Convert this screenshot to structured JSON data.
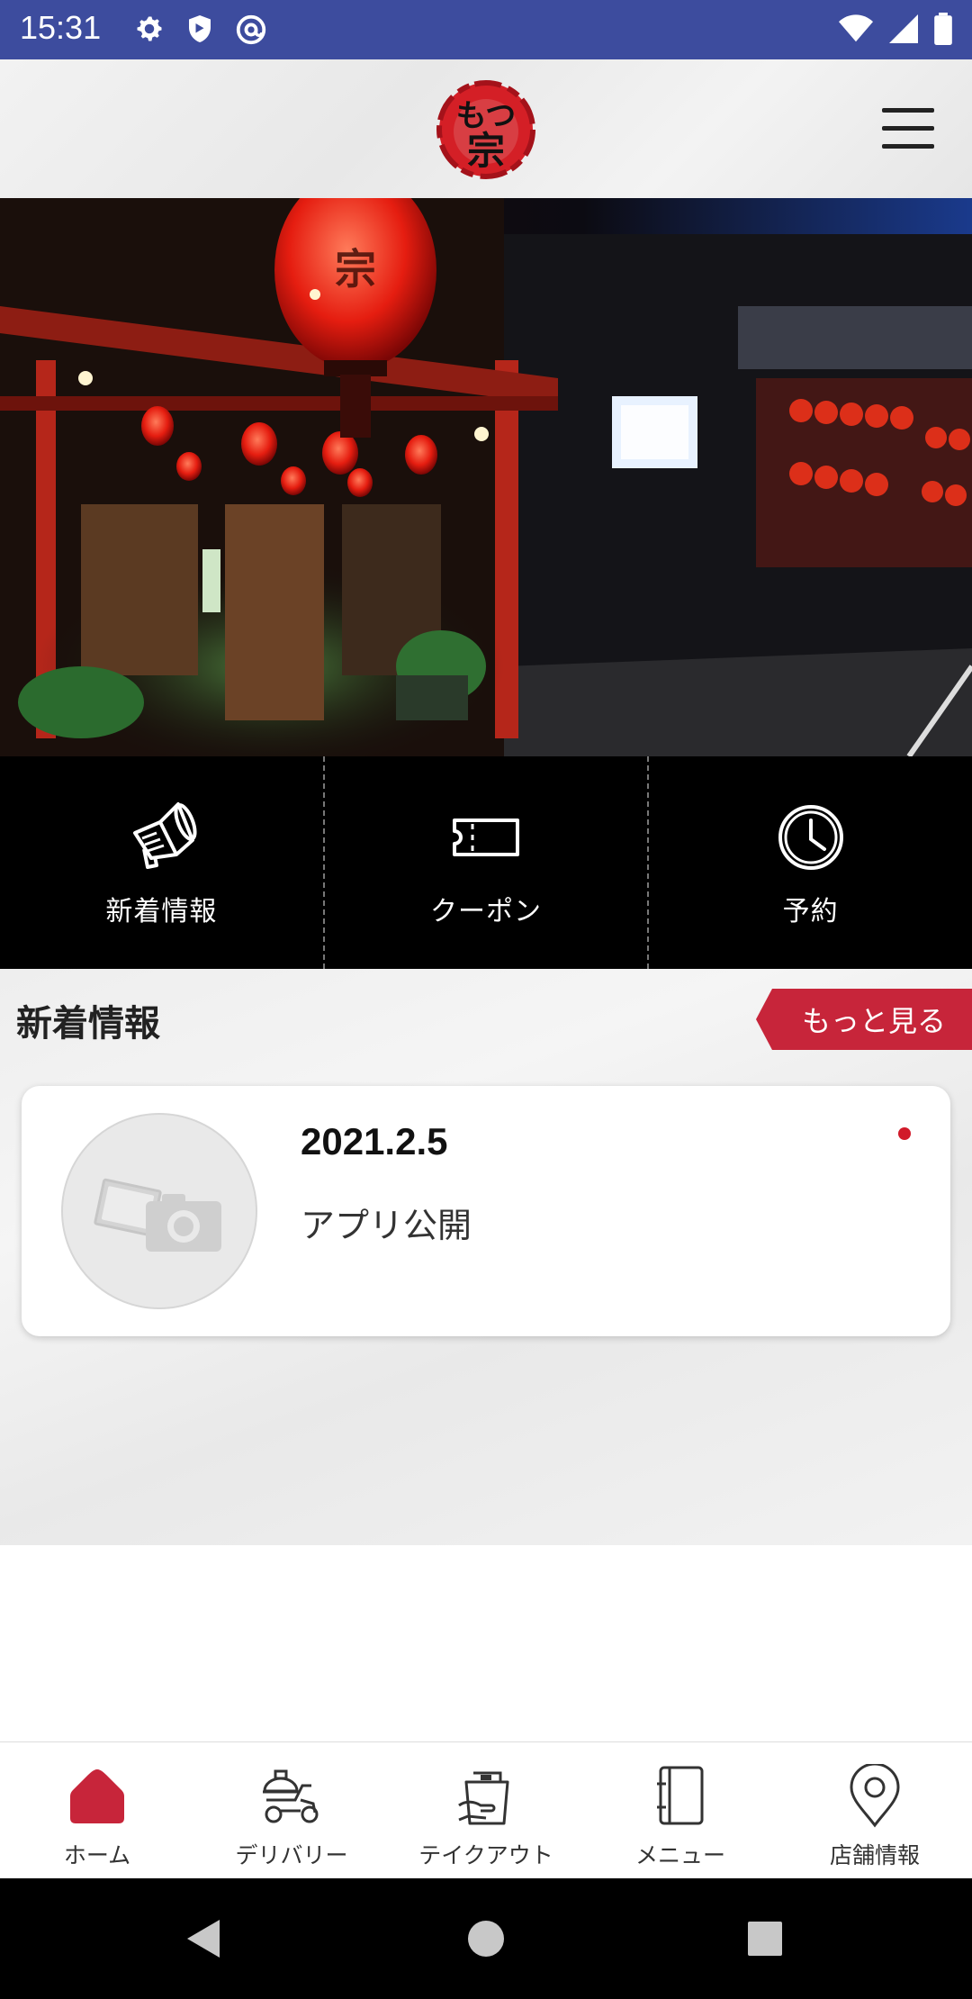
{
  "status_bar": {
    "time": "15:31",
    "left_icons": [
      "gear-icon",
      "shield-icon",
      "at-sync-icon"
    ],
    "right_icons": [
      "wifi-icon",
      "signal-icon",
      "battery-icon"
    ],
    "color": "#3d4c9e"
  },
  "header": {
    "logo_text": "もつ宗",
    "menu_icon": "hamburger-icon"
  },
  "quick_nav": [
    {
      "label": "新着情報",
      "icon": "megaphone-icon"
    },
    {
      "label": "クーポン",
      "icon": "ticket-icon"
    },
    {
      "label": "予約",
      "icon": "clock-icon"
    }
  ],
  "news": {
    "title": "新着情報",
    "more_label": "もっと見る",
    "accent": "#c7253a",
    "items": [
      {
        "date": "2021.2.5",
        "text": "アプリ公開",
        "unread": true
      }
    ]
  },
  "bottom_nav": [
    {
      "label": "ホーム",
      "icon": "home-icon",
      "active": true
    },
    {
      "label": "デリバリー",
      "icon": "delivery-scooter-icon",
      "active": false
    },
    {
      "label": "テイクアウト",
      "icon": "takeout-bag-icon",
      "active": false
    },
    {
      "label": "メニュー",
      "icon": "menu-book-icon",
      "active": false
    },
    {
      "label": "店舗情報",
      "icon": "location-pin-icon",
      "active": false
    }
  ]
}
